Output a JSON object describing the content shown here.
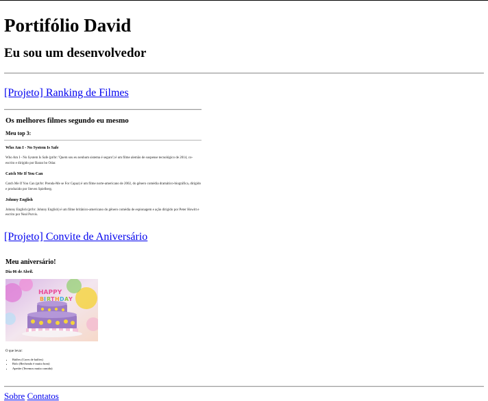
{
  "header": {
    "title": "Portifólio David",
    "subtitle": "Eu sou um desenvolvedor"
  },
  "projects": [
    {
      "link_text": "[Projeto] Ranking de Filmes",
      "preview": {
        "title": "Os melhores filmes segundo eu mesmo",
        "subtitle": "Meu top 3:",
        "movies": [
          {
            "name": "Who Am I - No System Is Safe",
            "description": "Who Am I - No System Is Safe (pt/br: 'Quem sou eu nenhum sistema é seguro') é um filme alemão de suspense tecnológico de 2014, co-escrito e dirigido por Baran bo Odar."
          },
          {
            "name": "Catch Me If You Can",
            "description": "Catch Me If You Can (pt/br: Prenda-Me se For Capaz) é um filme norte-americano de 2002, do gênero comédia dramático-biográfica, dirigido e produzido por Steven Spielberg."
          },
          {
            "name": "Johnny English",
            "description": "Johnny English (pt/br: Johnny English) é um filme britânico-americano do gênero comédia de espionagem e ação dirigido por Peter Howitt e escrito por Neal Purvis."
          }
        ]
      }
    },
    {
      "link_text": "[Projeto] Convite de Aniversário",
      "preview": {
        "title": "Meu aniversário!",
        "date": "Dia 06 de Abril.",
        "bring_label": "O que levar:",
        "items": [
          "Balões (Cores de balões)",
          "Bolo (Recheado é muito bom)",
          "Apetite (Teremos muita comida)"
        ]
      }
    }
  ],
  "footer": {
    "links": [
      "Sobre",
      "Contatos"
    ]
  }
}
